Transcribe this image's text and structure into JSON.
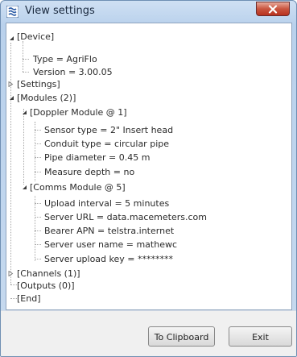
{
  "window": {
    "title": "View settings"
  },
  "tree": {
    "device": {
      "label": "[Device]",
      "type": "Type = AgriFlo",
      "version": "Version = 3.00.05"
    },
    "settings": {
      "label": "[Settings]"
    },
    "modules": {
      "label": "[Modules (2)]",
      "doppler": {
        "label": "[Doppler Module @ 1]",
        "items": [
          "Sensor type = 2\" Insert head",
          "Conduit type = circular pipe",
          "Pipe diameter = 0.45 m",
          "Measure depth = no"
        ]
      },
      "comms": {
        "label": "[Comms Module @ 5]",
        "items": [
          "Upload interval = 5 minutes",
          "Server URL = data.macemeters.com",
          "Bearer APN = telstra.internet",
          "Server user name = mathewc",
          "Server upload key = ********"
        ]
      }
    },
    "channels": {
      "label": "[Channels (1)]"
    },
    "outputs": {
      "label": "[Outputs (0)]"
    },
    "end": {
      "label": "[End]"
    }
  },
  "buttons": {
    "clipboard": "To Clipboard",
    "exit": "Exit"
  }
}
